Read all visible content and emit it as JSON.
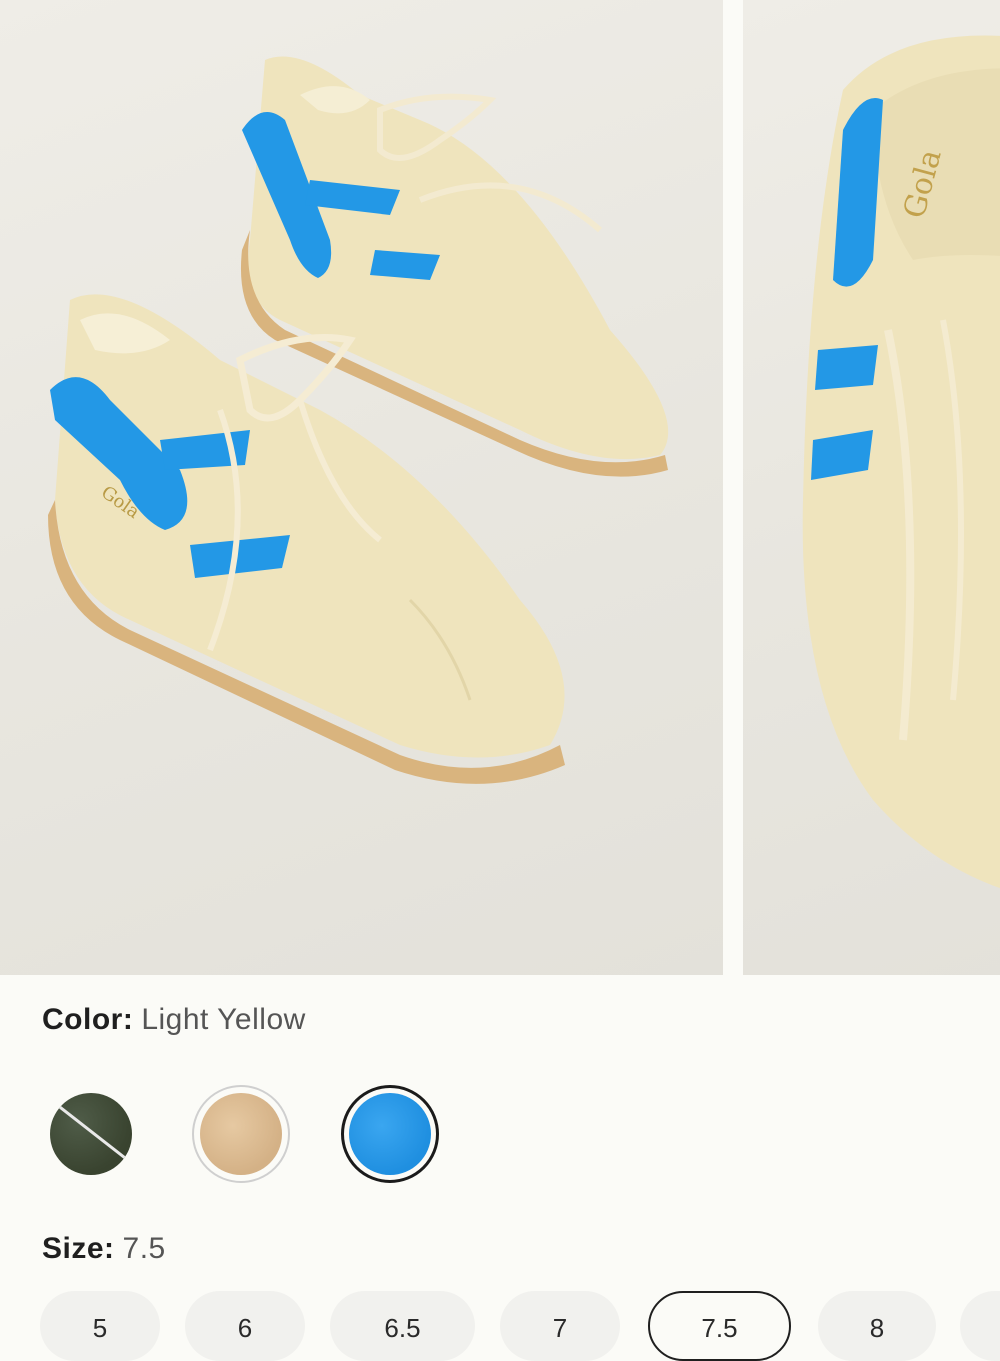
{
  "product": {
    "images": [
      {
        "name": "Gola sneakers pair, light yellow suede with blue stripes"
      },
      {
        "name": "Gola sneaker top view"
      }
    ],
    "color_label": "Color:",
    "color_value": "Light Yellow",
    "swatches": [
      {
        "name": "dark-green",
        "color": "#3f4a36",
        "unavailable": true,
        "selected": false
      },
      {
        "name": "sand",
        "color": "#dcbd94",
        "unavailable": false,
        "selected": false
      },
      {
        "name": "blue",
        "color": "#2398e6",
        "unavailable": false,
        "selected": true
      }
    ],
    "size_label": "Size:",
    "size_value": "7.5",
    "sizes": [
      {
        "label": "5",
        "selected": false
      },
      {
        "label": "6",
        "selected": false
      },
      {
        "label": "6.5",
        "selected": false
      },
      {
        "label": "7",
        "selected": false
      },
      {
        "label": "7.5",
        "selected": true
      },
      {
        "label": "8",
        "selected": false
      }
    ]
  },
  "colors": {
    "accent_blue": "#2398e6",
    "suede": "#efe4bd",
    "gum_sole": "#d8b784",
    "background": "#fbfbf7"
  }
}
